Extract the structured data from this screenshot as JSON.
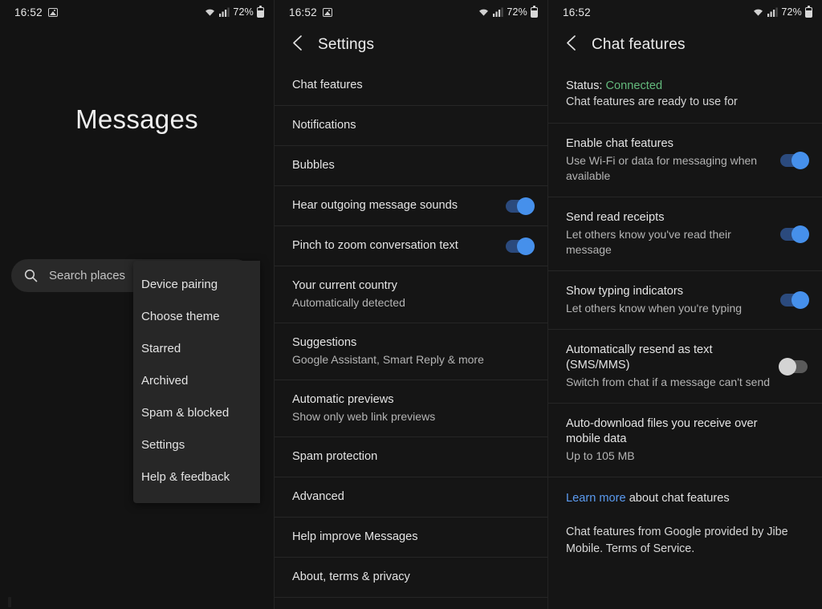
{
  "statusbar": {
    "time": "16:52",
    "battery": "72%",
    "icons": {
      "image": "image-icon",
      "wifi": "wifi-icon",
      "signal": "cellular-signal-icon",
      "battery": "battery-icon"
    }
  },
  "panel1": {
    "app_title": "Messages",
    "search": {
      "placeholder": "Search places",
      "icon": "search-icon"
    },
    "menu": {
      "items": [
        {
          "label": "Device pairing"
        },
        {
          "label": "Choose theme"
        },
        {
          "label": "Starred"
        },
        {
          "label": "Archived"
        },
        {
          "label": "Spam & blocked"
        },
        {
          "label": "Settings"
        },
        {
          "label": "Help & feedback"
        }
      ]
    }
  },
  "panel2": {
    "header": {
      "title": "Settings",
      "back_icon": "back-chevron-icon"
    },
    "rows": [
      {
        "title": "Chat features",
        "sub": "",
        "toggle": null
      },
      {
        "title": "Notifications",
        "sub": "",
        "toggle": null
      },
      {
        "title": "Bubbles",
        "sub": "",
        "toggle": null
      },
      {
        "title": "Hear outgoing message sounds",
        "sub": "",
        "toggle": "on"
      },
      {
        "title": "Pinch to zoom conversation text",
        "sub": "",
        "toggle": "on"
      },
      {
        "title": "Your current country",
        "sub": "Automatically detected",
        "toggle": null
      },
      {
        "title": "Suggestions",
        "sub": "Google Assistant, Smart Reply & more",
        "toggle": null
      },
      {
        "title": "Automatic previews",
        "sub": "Show only web link previews",
        "toggle": null
      },
      {
        "title": "Spam protection",
        "sub": "",
        "toggle": null
      },
      {
        "title": "Advanced",
        "sub": "",
        "toggle": null
      },
      {
        "title": "Help improve Messages",
        "sub": "",
        "toggle": null
      },
      {
        "title": "About, terms & privacy",
        "sub": "",
        "toggle": null
      }
    ]
  },
  "panel3": {
    "header": {
      "title": "Chat features",
      "back_icon": "back-chevron-icon"
    },
    "status": {
      "label": "Status:",
      "value": "Connected",
      "sub": "Chat features are ready to use for"
    },
    "rows": [
      {
        "title": "Enable chat features",
        "sub": "Use Wi-Fi or data for messaging when available",
        "toggle": "on"
      },
      {
        "title": "Send read receipts",
        "sub": "Let others know you've read their message",
        "toggle": "on"
      },
      {
        "title": "Show typing indicators",
        "sub": "Let others know when you're typing",
        "toggle": "on"
      },
      {
        "title": "Automatically resend as text (SMS/MMS)",
        "sub": "Switch from chat if a message can't send",
        "toggle": "off"
      },
      {
        "title": "Auto-download files you receive over mobile data",
        "sub": "Up to 105 MB",
        "toggle": null
      }
    ],
    "learn": {
      "link": "Learn more",
      "rest": " about chat features"
    },
    "footer": "Chat features from Google provided by Jibe Mobile. Terms of Service."
  },
  "colors": {
    "accent_blue": "#4690eb",
    "status_green": "#63b97c",
    "link_blue": "#5b9bf0",
    "background": "#131313",
    "toggle_off": "#5a5a5a"
  }
}
